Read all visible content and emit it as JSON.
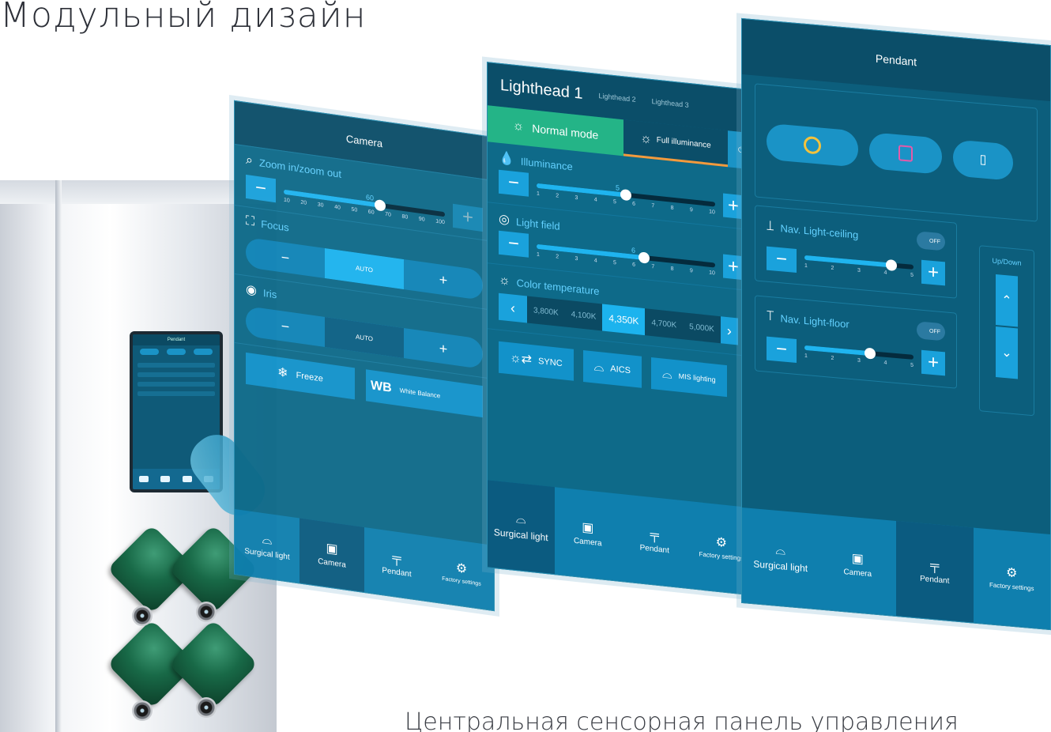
{
  "headline": "Модульный дизайн",
  "caption": "Центральная сенсорная панель управления",
  "nav": {
    "surgical_light": "Surgical light",
    "camera": "Camera",
    "pendant": "Pendant",
    "factory_settings": "Factory settings"
  },
  "mini_panel": {
    "title": "Pendant"
  },
  "camera_panel": {
    "title": "Camera",
    "zoom_label": "Zoom in/zoom out",
    "zoom_value": "60",
    "zoom_ticks": [
      "10",
      "20",
      "30",
      "40",
      "50",
      "60",
      "70",
      "80",
      "90",
      "100"
    ],
    "zoom_level_pct": 60,
    "focus_label": "Focus",
    "focus_mode": "AUTO",
    "iris_label": "Iris",
    "iris_mode": "AUTO",
    "freeze_label": "Freeze",
    "wb_short": "WB",
    "wb_label": "White Balance",
    "minus": "−",
    "plus": "+"
  },
  "lighthead_panel": {
    "title": "Lighthead 1",
    "tab2": "Lighthead 2",
    "tab3": "Lighthead 3",
    "normal_mode": "Normal mode",
    "full_illuminance": "Full illuminance",
    "illuminance_label": "Illuminance",
    "illuminance_value": "5",
    "light_field_label": "Light field",
    "light_field_value": "6",
    "scale_ticks": [
      "1",
      "2",
      "3",
      "4",
      "5",
      "6",
      "7",
      "8",
      "9",
      "10"
    ],
    "color_temp_label": "Color temperature",
    "color_temps": [
      "3,800K",
      "4,100K",
      "4,350K",
      "4,700K",
      "5,000K"
    ],
    "color_temp_selected": "4,350K",
    "sync_label": "SYNC",
    "aics_label": "AICS",
    "mis_label": "MIS lighting"
  },
  "pendant_panel": {
    "title": "Pendant",
    "ceiling_label": "Nav. Light-ceiling",
    "ceiling_toggle": "OFF",
    "floor_label": "Nav. Light-floor",
    "floor_toggle": "OFF",
    "scale_ticks": [
      "1",
      "2",
      "3",
      "4",
      "5"
    ],
    "ceiling_level": 4,
    "floor_level": 3,
    "updown_label": "Up/Down"
  },
  "colors": {
    "panel": "#0e6a89",
    "accent": "#1cb3ee",
    "normal_mode": "#24b487",
    "knob": "#186947"
  }
}
